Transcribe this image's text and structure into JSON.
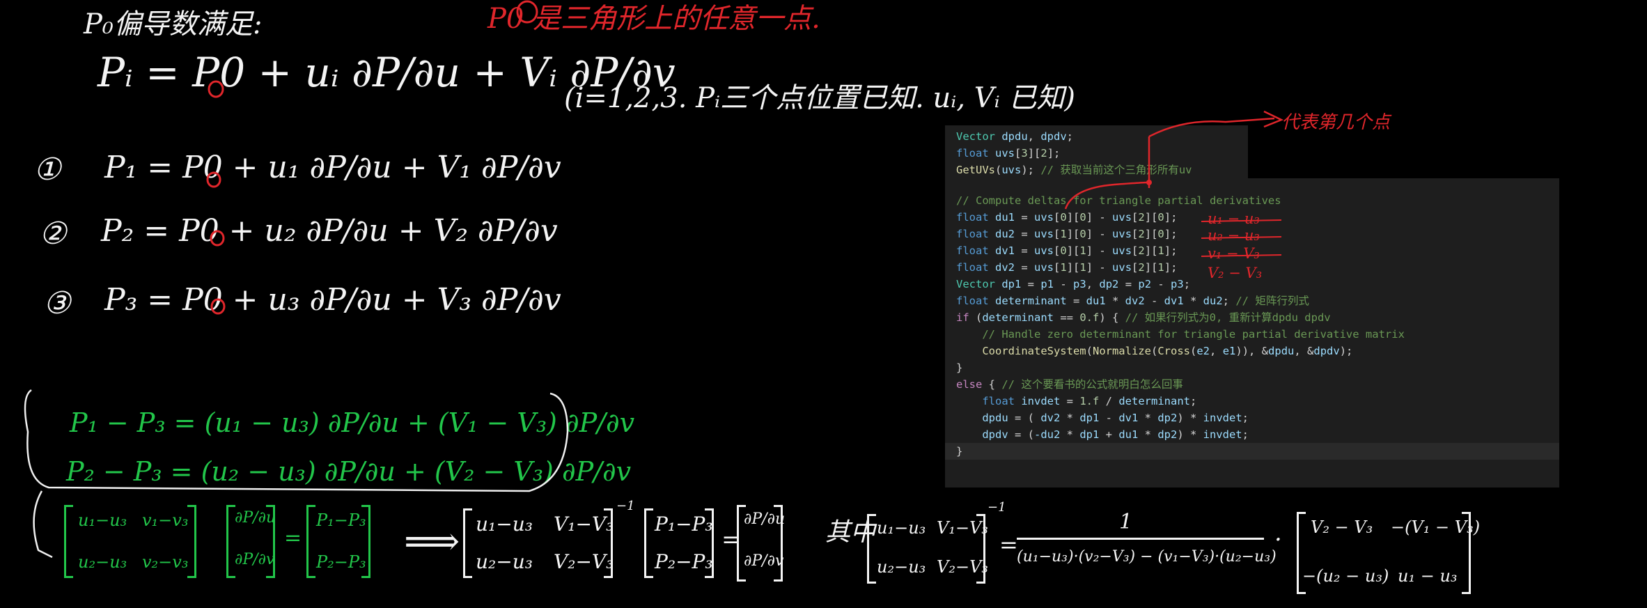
{
  "handwriting": {
    "title": "P₀偏导数满足:",
    "p0_note": "P0 是三角形上的任意一点.",
    "main_eq": "Pᵢ = P0 + uᵢ ∂P/∂u + Vᵢ ∂P/∂v",
    "main_note": "(i=1,2,3.  Pᵢ三个点位置已知. uᵢ, Vᵢ 已知)",
    "eq1_label": "①",
    "eq1": "P₁ = P0 + u₁ ∂P/∂u + V₁ ∂P/∂v",
    "eq2_label": "②",
    "eq2": "P₂ = P0 + u₂ ∂P/∂u + V₂ ∂P/∂v",
    "eq3_label": "③",
    "eq3": "P₃ = P0 + u₃ ∂P/∂u + V₃ ∂P/∂v",
    "green_eq1": "P₁ − P₃ =  (u₁ − u₃) ∂P/∂u   +   (V₁ − V₃) ∂P/∂v",
    "green_eq2": "P₂ − P₃  =  (u₂ − u₃) ∂P/∂u   +   (V₂ − V₃) ∂P/∂v",
    "matrix_a": [
      "u₁−u₃",
      "v₁−v₃",
      "u₂−u₃",
      "v₂−v₃"
    ],
    "matrix_b": [
      "∂P/∂u",
      "∂P/∂v"
    ],
    "matrix_c": [
      "P₁−P₃",
      "P₂−P₃"
    ],
    "equals": "=",
    "implies": "⟹",
    "inv_matrix": [
      "u₁−u₃",
      "V₁−V₃",
      "u₂−u₃",
      "V₂−V₃"
    ],
    "inv_exp": "−1",
    "rhs_matrix": [
      "P₁−P₃",
      "P₂−P₃"
    ],
    "result_matrix": [
      "∂P/∂u",
      "∂P/∂v"
    ],
    "where_label": "其中",
    "det_numerator": "1",
    "det_denominator": "(u₁−u₃)·(v₂−V₃) − (v₁−V₃)·(u₂−u₃)",
    "dot": "·",
    "adj_matrix": [
      "V₂ − V₃",
      "−(V₁ − V₃)",
      "−(u₂ − u₃)",
      "u₁ − u₃"
    ],
    "arrow_note": "代表第几个点"
  },
  "code_top": [
    {
      "parts": [
        [
          "ty",
          "Vector"
        ],
        [
          "var",
          " dpdu"
        ],
        [
          "pl",
          ", "
        ],
        [
          "var",
          "dpdv"
        ],
        [
          "pl",
          ";"
        ]
      ]
    },
    {
      "parts": [
        [
          "kw",
          "float"
        ],
        [
          "pl",
          " "
        ],
        [
          "var",
          "uvs"
        ],
        [
          "pl",
          "["
        ],
        [
          "num",
          "3"
        ],
        [
          "pl",
          "]["
        ],
        [
          "num",
          "2"
        ],
        [
          "pl",
          "];"
        ]
      ]
    },
    {
      "parts": [
        [
          "fn",
          "GetUVs"
        ],
        [
          "pl",
          "("
        ],
        [
          "var",
          "uvs"
        ],
        [
          "pl",
          "); "
        ],
        [
          "cm",
          "// 获取当前这个三角形所有uv"
        ]
      ]
    }
  ],
  "code_main": [
    {
      "parts": [
        [
          "cm",
          "// Compute deltas for triangle partial derivatives"
        ]
      ]
    },
    {
      "parts": [
        [
          "kw",
          "float"
        ],
        [
          "pl",
          " "
        ],
        [
          "var",
          "du1"
        ],
        [
          "pl",
          " = "
        ],
        [
          "var",
          "uvs"
        ],
        [
          "pl",
          "["
        ],
        [
          "num",
          "0"
        ],
        [
          "pl",
          "]["
        ],
        [
          "num",
          "0"
        ],
        [
          "pl",
          "] - "
        ],
        [
          "var",
          "uvs"
        ],
        [
          "pl",
          "["
        ],
        [
          "num",
          "2"
        ],
        [
          "pl",
          "]["
        ],
        [
          "num",
          "0"
        ],
        [
          "pl",
          "];"
        ]
      ]
    },
    {
      "parts": [
        [
          "kw",
          "float"
        ],
        [
          "pl",
          " "
        ],
        [
          "var",
          "du2"
        ],
        [
          "pl",
          " = "
        ],
        [
          "var",
          "uvs"
        ],
        [
          "pl",
          "["
        ],
        [
          "num",
          "1"
        ],
        [
          "pl",
          "]["
        ],
        [
          "num",
          "0"
        ],
        [
          "pl",
          "] - "
        ],
        [
          "var",
          "uvs"
        ],
        [
          "pl",
          "["
        ],
        [
          "num",
          "2"
        ],
        [
          "pl",
          "]["
        ],
        [
          "num",
          "0"
        ],
        [
          "pl",
          "];"
        ]
      ]
    },
    {
      "parts": [
        [
          "kw",
          "float"
        ],
        [
          "pl",
          " "
        ],
        [
          "var",
          "dv1"
        ],
        [
          "pl",
          " = "
        ],
        [
          "var",
          "uvs"
        ],
        [
          "pl",
          "["
        ],
        [
          "num",
          "0"
        ],
        [
          "pl",
          "]["
        ],
        [
          "num",
          "1"
        ],
        [
          "pl",
          "] - "
        ],
        [
          "var",
          "uvs"
        ],
        [
          "pl",
          "["
        ],
        [
          "num",
          "2"
        ],
        [
          "pl",
          "]["
        ],
        [
          "num",
          "1"
        ],
        [
          "pl",
          "];"
        ]
      ]
    },
    {
      "parts": [
        [
          "kw",
          "float"
        ],
        [
          "pl",
          " "
        ],
        [
          "var",
          "dv2"
        ],
        [
          "pl",
          " = "
        ],
        [
          "var",
          "uvs"
        ],
        [
          "pl",
          "["
        ],
        [
          "num",
          "1"
        ],
        [
          "pl",
          "]["
        ],
        [
          "num",
          "1"
        ],
        [
          "pl",
          "] - "
        ],
        [
          "var",
          "uvs"
        ],
        [
          "pl",
          "["
        ],
        [
          "num",
          "2"
        ],
        [
          "pl",
          "]["
        ],
        [
          "num",
          "1"
        ],
        [
          "pl",
          "];"
        ]
      ]
    },
    {
      "parts": [
        [
          "ty",
          "Vector"
        ],
        [
          "pl",
          " "
        ],
        [
          "var",
          "dp1"
        ],
        [
          "pl",
          " = "
        ],
        [
          "var",
          "p1"
        ],
        [
          "pl",
          " - "
        ],
        [
          "var",
          "p3"
        ],
        [
          "pl",
          ", "
        ],
        [
          "var",
          "dp2"
        ],
        [
          "pl",
          " = "
        ],
        [
          "var",
          "p2"
        ],
        [
          "pl",
          " - "
        ],
        [
          "var",
          "p3"
        ],
        [
          "pl",
          ";"
        ]
      ]
    },
    {
      "parts": [
        [
          "kw",
          "float"
        ],
        [
          "pl",
          " "
        ],
        [
          "var",
          "determinant"
        ],
        [
          "pl",
          " = "
        ],
        [
          "var",
          "du1"
        ],
        [
          "pl",
          " * "
        ],
        [
          "var",
          "dv2"
        ],
        [
          "pl",
          " - "
        ],
        [
          "var",
          "dv1"
        ],
        [
          "pl",
          " * "
        ],
        [
          "var",
          "du2"
        ],
        [
          "pl",
          "; "
        ],
        [
          "cm",
          "// 矩阵行列式"
        ]
      ]
    },
    {
      "parts": [
        [
          "ctl",
          "if"
        ],
        [
          "pl",
          " ("
        ],
        [
          "var",
          "determinant"
        ],
        [
          "pl",
          " == "
        ],
        [
          "num",
          "0.f"
        ],
        [
          "pl",
          ") { "
        ],
        [
          "cm",
          "// 如果行列式为0, 重新计算dpdu dpdv"
        ]
      ]
    },
    {
      "parts": [
        [
          "pl",
          "    "
        ],
        [
          "cm",
          "// Handle zero determinant for triangle partial derivative matrix"
        ]
      ]
    },
    {
      "parts": [
        [
          "pl",
          "    "
        ],
        [
          "fn",
          "CoordinateSystem"
        ],
        [
          "pl",
          "("
        ],
        [
          "fn",
          "Normalize"
        ],
        [
          "pl",
          "("
        ],
        [
          "fn",
          "Cross"
        ],
        [
          "pl",
          "("
        ],
        [
          "var",
          "e2"
        ],
        [
          "pl",
          ", "
        ],
        [
          "var",
          "e1"
        ],
        [
          "pl",
          ")), &"
        ],
        [
          "var",
          "dpdu"
        ],
        [
          "pl",
          ", &"
        ],
        [
          "var",
          "dpdv"
        ],
        [
          "pl",
          ");"
        ]
      ]
    },
    {
      "parts": [
        [
          "pl",
          "}"
        ]
      ]
    },
    {
      "parts": [
        [
          "ctl",
          "else"
        ],
        [
          "pl",
          " { "
        ],
        [
          "cm",
          "// 这个要看书的公式就明白怎么回事"
        ]
      ]
    },
    {
      "parts": [
        [
          "pl",
          "    "
        ],
        [
          "kw",
          "float"
        ],
        [
          "pl",
          " "
        ],
        [
          "var",
          "invdet"
        ],
        [
          "pl",
          " = "
        ],
        [
          "num",
          "1.f"
        ],
        [
          "pl",
          " / "
        ],
        [
          "var",
          "determinant"
        ],
        [
          "pl",
          ";"
        ]
      ]
    },
    {
      "parts": [
        [
          "pl",
          "    "
        ],
        [
          "var",
          "dpdu"
        ],
        [
          "pl",
          " = ( "
        ],
        [
          "var",
          "dv2"
        ],
        [
          "pl",
          " * "
        ],
        [
          "var",
          "dp1"
        ],
        [
          "pl",
          " - "
        ],
        [
          "var",
          "dv1"
        ],
        [
          "pl",
          " * "
        ],
        [
          "var",
          "dp2"
        ],
        [
          "pl",
          ") * "
        ],
        [
          "var",
          "invdet"
        ],
        [
          "pl",
          ";"
        ]
      ]
    },
    {
      "parts": [
        [
          "pl",
          "    "
        ],
        [
          "var",
          "dpdv"
        ],
        [
          "pl",
          " = ("
        ],
        [
          "var",
          "-du2"
        ],
        [
          "pl",
          " * "
        ],
        [
          "var",
          "dp1"
        ],
        [
          "pl",
          " + "
        ],
        [
          "var",
          "du1"
        ],
        [
          "pl",
          " * "
        ],
        [
          "var",
          "dp2"
        ],
        [
          "pl",
          ") * "
        ],
        [
          "var",
          "invdet"
        ],
        [
          "pl",
          ";"
        ]
      ]
    },
    {
      "parts": [
        [
          "pl",
          "}"
        ]
      ]
    }
  ],
  "code_annotations": [
    "u₁ − u₃",
    "u₂ − u₃",
    "v₁ − V₃",
    "V₂ − V₃"
  ],
  "colors": {
    "background": "#000000",
    "red": "#e0262b",
    "green": "#22c64a",
    "panel": "#1e1e1e"
  }
}
